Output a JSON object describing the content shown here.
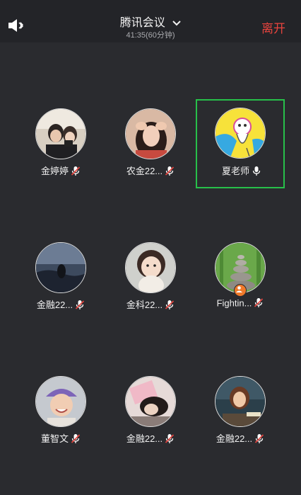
{
  "header": {
    "title": "腾讯会议",
    "subtitle": "41:35(60分钟)",
    "leave_label": "离开",
    "accent_color": "#e8443e"
  },
  "participants": [
    {
      "name": "金婷婷",
      "mic": "muted",
      "active": false,
      "avatar": "photo-two-girls"
    },
    {
      "name": "农金22...",
      "mic": "muted",
      "active": false,
      "avatar": "photo-girl-hands"
    },
    {
      "name": "夏老师",
      "mic": "on",
      "active": true,
      "avatar": "cartoon-yellow"
    },
    {
      "name": "金融22...",
      "mic": "muted",
      "active": false,
      "avatar": "photo-night-field"
    },
    {
      "name": "金科22...",
      "mic": "muted",
      "active": false,
      "avatar": "photo-baby"
    },
    {
      "name": "Fightin...",
      "mic": "muted",
      "active": false,
      "avatar": "photo-stones-bamboo",
      "host_badge": true
    },
    {
      "name": "董智文",
      "mic": "muted",
      "active": false,
      "avatar": "photo-child-hat"
    },
    {
      "name": "金融22...",
      "mic": "muted",
      "active": false,
      "avatar": "photo-girl-sleeping"
    },
    {
      "name": "金融22...",
      "mic": "muted",
      "active": false,
      "avatar": "illustration-girl-desk"
    }
  ]
}
